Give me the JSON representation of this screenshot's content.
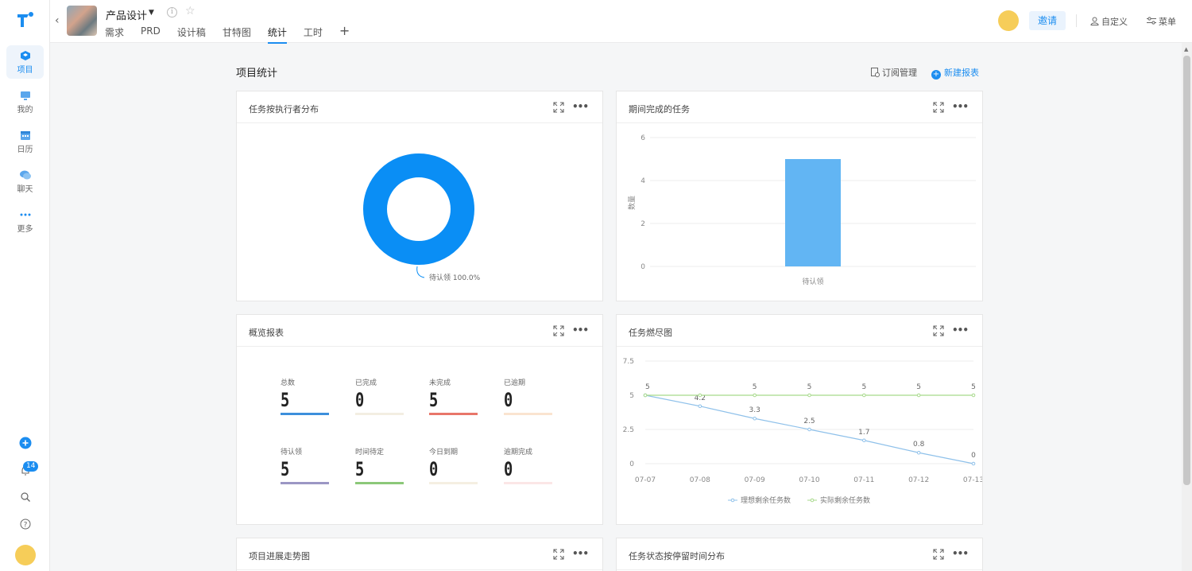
{
  "rail": {
    "items": [
      {
        "label": "项目"
      },
      {
        "label": "我的"
      },
      {
        "label": "日历"
      },
      {
        "label": "聊天"
      },
      {
        "label": "更多"
      }
    ],
    "notification_count": "14"
  },
  "header": {
    "project_name": "产品设计",
    "tabs": [
      "需求",
      "PRD",
      "设计稿",
      "甘特图",
      "统计",
      "工时"
    ],
    "active_tab": "统计",
    "invite_label": "邀请",
    "customize_label": "自定义",
    "menu_label": "菜单"
  },
  "page": {
    "title": "项目统计",
    "subscribe_label": "订阅管理",
    "new_report_label": "新建报表"
  },
  "cards": {
    "assignee": {
      "title": "任务按执行者分布"
    },
    "completed": {
      "title": "期间完成的任务"
    },
    "overview": {
      "title": "概览报表"
    },
    "burndown": {
      "title": "任务燃尽图"
    },
    "progress": {
      "title": "项目进展走势图"
    },
    "status_time": {
      "title": "任务状态按停留时间分布"
    }
  },
  "overview": {
    "stats": [
      {
        "label": "总数",
        "value": "5",
        "color": "#3d8fdc"
      },
      {
        "label": "已完成",
        "value": "0",
        "color": "#f3eee2"
      },
      {
        "label": "未完成",
        "value": "5",
        "color": "#e8766a"
      },
      {
        "label": "已逾期",
        "value": "0",
        "color": "#fae4d0"
      },
      {
        "label": "待认领",
        "value": "5",
        "color": "#9b96c4"
      },
      {
        "label": "时间待定",
        "value": "5",
        "color": "#8cc879"
      },
      {
        "label": "今日到期",
        "value": "0",
        "color": "#f5efe2"
      },
      {
        "label": "逾期完成",
        "value": "0",
        "color": "#fbe6e6"
      }
    ]
  },
  "chart_data": [
    {
      "type": "pie",
      "donut": true,
      "slices": [
        {
          "label": "待认领",
          "value": 100.0,
          "display": "待认领 100.0%",
          "color": "#0a8ef5"
        }
      ]
    },
    {
      "type": "bar",
      "categories": [
        "待认领"
      ],
      "values": [
        5
      ],
      "ylabel": "数量",
      "ylim": [
        0,
        6
      ],
      "yticks": [
        0,
        2,
        4,
        6
      ],
      "color": "#62b5f3",
      "grid": true
    },
    {
      "type": "line",
      "x": [
        "07-07",
        "07-08",
        "07-09",
        "07-10",
        "07-11",
        "07-12",
        "07-13"
      ],
      "ylim": [
        0,
        7.5
      ],
      "yticks": [
        "0",
        "2.5",
        "5",
        "7.5"
      ],
      "series": [
        {
          "name": "理想剩余任务数",
          "values": [
            5,
            4.2,
            3.3,
            2.5,
            1.7,
            0.8,
            0
          ],
          "labels": [
            "5",
            "4.2",
            "3.3",
            "2.5",
            "1.7",
            "0.8",
            "0"
          ],
          "color": "#8fc1ea"
        },
        {
          "name": "实际剩余任务数",
          "values": [
            5,
            5,
            5,
            5,
            5,
            5,
            5
          ],
          "labels": [
            "5",
            "5",
            "5",
            "5",
            "5",
            "5",
            "5"
          ],
          "color": "#a7d98b"
        }
      ],
      "legend": "bottom",
      "grid": true
    }
  ]
}
